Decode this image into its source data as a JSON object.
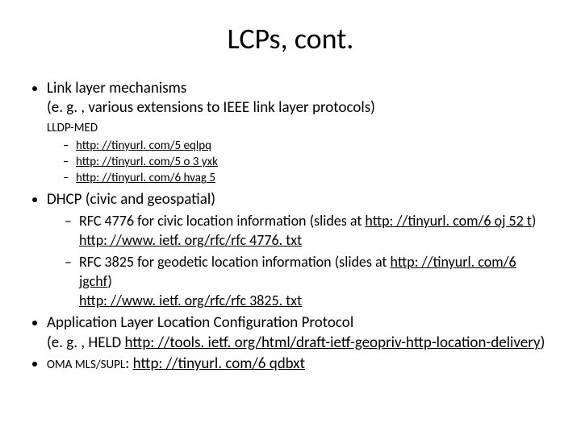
{
  "title": "LCPs, cont.",
  "b1": {
    "line1": "Link layer mechanisms",
    "line2": "(e. g. , various extensions to IEEE link layer protocols)",
    "lldp_label": "LLDP-MED",
    "links": [
      "http: //tinyurl. com/5 eqlpq",
      "http: //tinyurl. com/5 o 3 yxk",
      "http: //tinyurl. com/6 hvag 5"
    ]
  },
  "b2": {
    "lead": "DHCP (civic and geospatial)",
    "i1_pre": "RFC 4776 for civic location information (slides at ",
    "i1_link": "http: //tinyurl. com/6 oj 52 t",
    "i1_post": ")",
    "i1_url": "http: //www. ietf. org/rfc/rfc 4776. txt",
    "i2_pre": "RFC 3825 for geodetic location information (slides at ",
    "i2_link": "http: //tinyurl. com/6 jgchf",
    "i2_post": ")",
    "i2_url": "http: //www. ietf. org/rfc/rfc 3825. txt"
  },
  "b3": {
    "line1": "Application Layer Location Configuration Protocol",
    "line2_pre": "(e. g. , HELD ",
    "line2_link": "http: //tools. ietf. org/html/draft-ietf-geopriv-http-location-delivery",
    "line2_post": ")"
  },
  "b4": {
    "pre": "OMA MLS/SUPL",
    "colon": ": ",
    "link": "http: //tinyurl. com/6 qdbxt"
  }
}
